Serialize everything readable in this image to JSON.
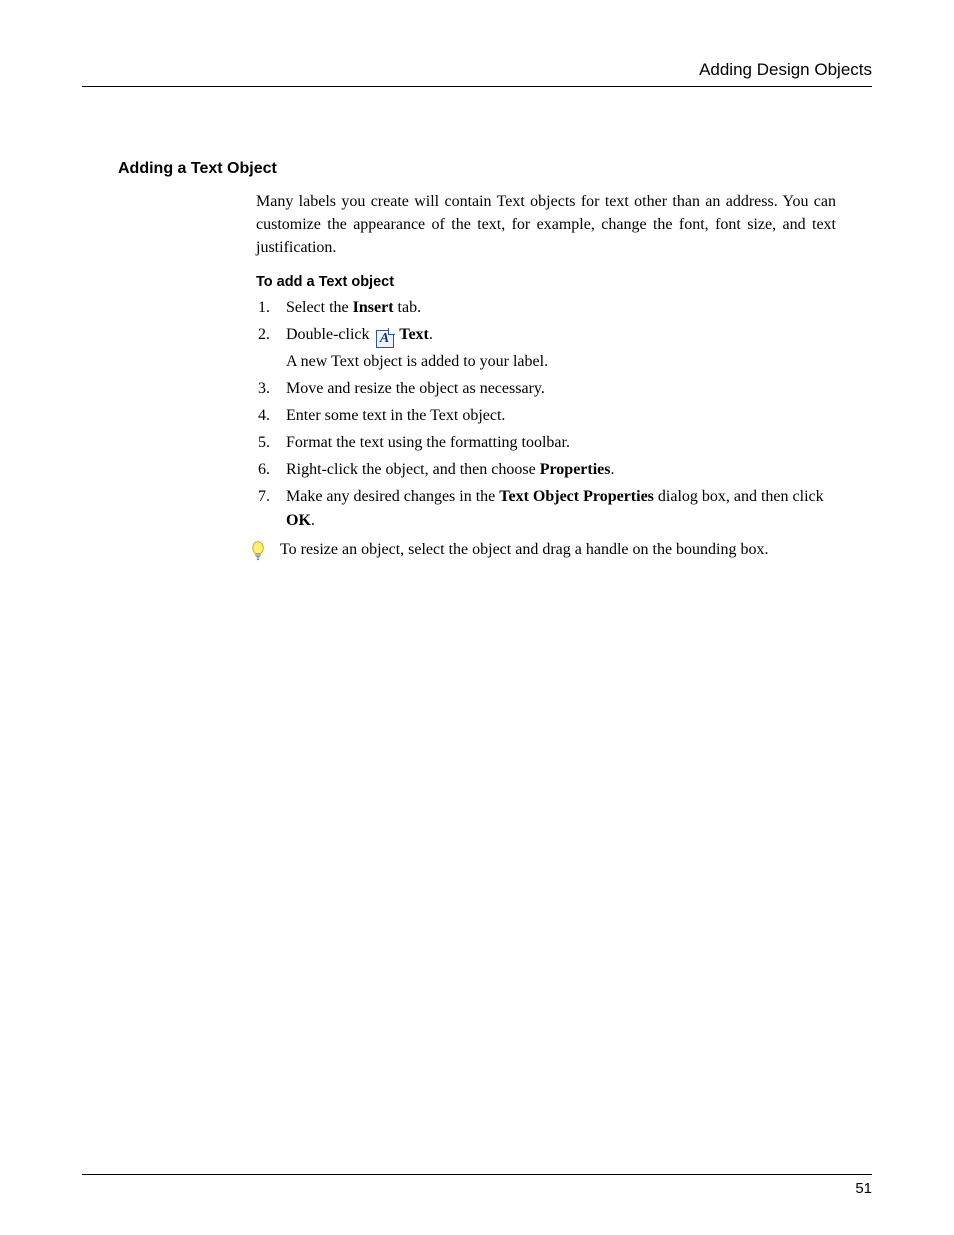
{
  "header": {
    "title": "Adding Design Objects"
  },
  "section": {
    "heading": "Adding a Text Object",
    "intro": "Many labels you create will contain Text objects for text other than an address. You can customize the appearance of the text, for example, change the font, font size, and text justification.",
    "sub_heading": "To add a Text object",
    "steps": {
      "s1_a": "Select the ",
      "s1_b": "Insert",
      "s1_c": " tab.",
      "s2_a": "Double-click ",
      "s2_icon_letter": "A",
      "s2_b": " Text",
      "s2_c": ".",
      "s2_extra": "A new Text object is added to your label.",
      "s3": "Move and resize the object as necessary.",
      "s4": "Enter some text in the Text object.",
      "s5": "Format the text using the formatting toolbar.",
      "s6_a": "Right-click the object, and then choose ",
      "s6_b": "Properties",
      "s6_c": ".",
      "s7_a": "Make any desired changes in the ",
      "s7_b": "Text Object Properties",
      "s7_c": " dialog box, and then click ",
      "s7_d": "OK",
      "s7_e": "."
    },
    "tip": "To resize an object, select the object and drag a handle on the bounding box."
  },
  "footer": {
    "page_number": "51"
  }
}
